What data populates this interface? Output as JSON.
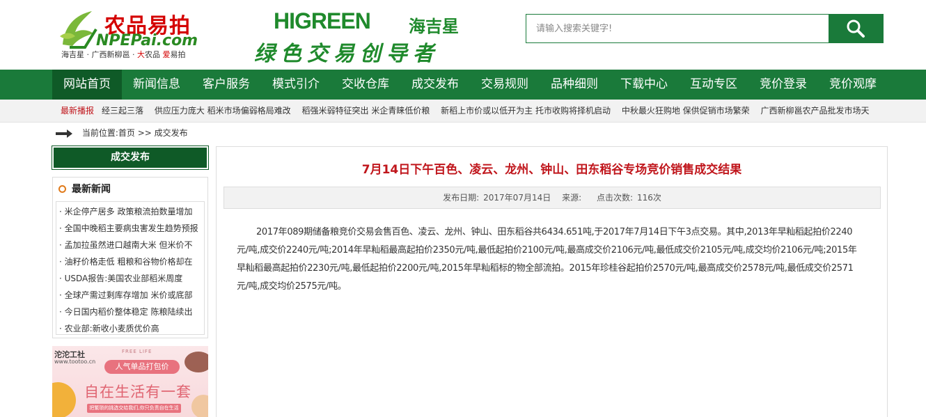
{
  "header": {
    "logo1": {
      "name_cn": "农品易拍",
      "name_en": "NPEPai.com",
      "tagline_parts": [
        "海吉星 · 广西新柳邕 · ",
        "大",
        "农品 ",
        "爱",
        "易拍"
      ]
    },
    "logo2": {
      "name_en": "HIGREEN",
      "name_cn": "海吉星",
      "slogan": "绿色交易创导者"
    },
    "search": {
      "placeholder": "请输入搜索关键字!"
    },
    "colors": {
      "brand_green": "#1a7a3a",
      "dark_green": "#0f5a27",
      "accent_red": "#c0161c"
    }
  },
  "nav": {
    "items": [
      "网站首页",
      "新闻信息",
      "客户服务",
      "模式引介",
      "交收仓库",
      "成交发布",
      "交易规则",
      "品种细则",
      "下载中心",
      "互动专区",
      "竞价登录",
      "竞价观摩"
    ],
    "active_index": 0
  },
  "ticker": {
    "label": "最新播报",
    "items": [
      "经三起三落",
      "供应压力庞大 稻米市场偏弱格局难改",
      "稻强米弱特征突出 米企青睐低价粮",
      "新稻上市价或以低开为主 托市收购将择机启动",
      "中秋最火狂购地 保供促销市场繁荣",
      "广西新柳邕农产品批发市场天"
    ]
  },
  "breadcrumb": {
    "prefix": "当前位置:",
    "home": "首页",
    "sep": " >> ",
    "current": "成交发布"
  },
  "sidebar": {
    "title": "成交发布",
    "news_head": "最新新闻",
    "news_items": [
      "· 米企停产居多 政策粮流拍数量增加",
      "· 全国中晚稻主要病虫害发生趋势预报",
      "· 孟加拉虽然进口越南大米 但米价不",
      "· 油籽价格走低 粗粮和谷物价格却在",
      "· USDA报告:美国农业部稻米周度",
      "· 全球产需过剩库存增加 米价或底部",
      "· 今日国内稻价整体稳定 陈粮陆续出",
      "· 农业部:新收小麦质优价高"
    ],
    "ad": {
      "logo": "沱沱工社",
      "url": "www.tootoo.cn",
      "free": "FREE LIFE",
      "pill": "人气单品打包价",
      "big": "自在生活有一套",
      "small": "把繁琐的挑选交给我们,你只负责自在生活"
    }
  },
  "article": {
    "title": "7月14日下午百色、凌云、龙州、钟山、田东稻谷专场竞价销售成交结果",
    "meta": {
      "date_label": "发布日期:",
      "date": "2017年07月14日",
      "source_label": "来源:",
      "source": "",
      "clicks_label": "点击次数:",
      "clicks": "116次"
    },
    "body": "2017年089期储备粮竞价交易会售百色、凌云、龙州、钟山、田东稻谷共6434.651吨,于2017年7月14日下午3点交易。其中,2013年早籼稻起拍价2240元/吨,成交价2240元/吨;2014年早籼稻最高起拍价2350元/吨,最低起拍价2100元/吨,最高成交价2106元/吨,最低成交价2105元/吨,成交均价2106元/吨;2015年早籼稻最高起拍价2230元/吨,最低起拍价2200元/吨,2015年早籼稻标的物全部流拍。2015年珍桂谷起拍价2570元/吨,最高成交价2578元/吨,最低成交价2571元/吨,成交均价2575元/吨。"
  }
}
